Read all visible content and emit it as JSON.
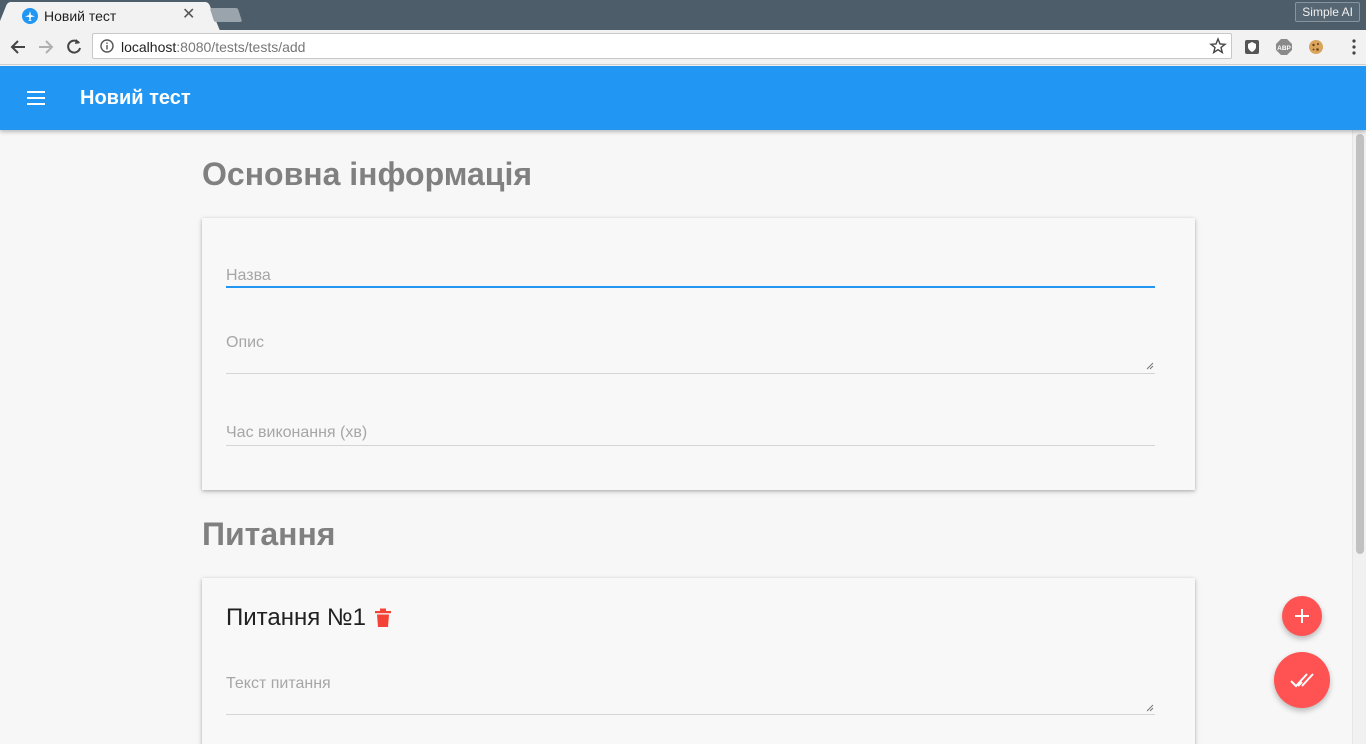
{
  "browser": {
    "tab_title": "Новий тест",
    "tab_close": "✕",
    "profile_name": "Simple AI",
    "url_host": "localhost",
    "url_path": ":8080/tests/tests/add"
  },
  "appbar": {
    "title": "Новий тест",
    "color": "#2196f3"
  },
  "main_info": {
    "heading": "Основна інформація",
    "fields": {
      "name_placeholder": "Назва",
      "description_placeholder": "Опис",
      "time_placeholder": "Час виконання (хв)"
    }
  },
  "questions": {
    "heading": "Питання",
    "items": [
      {
        "title": "Питання №1",
        "text_placeholder": "Текст питання"
      }
    ]
  },
  "colors": {
    "accent": "#ff5252",
    "primary": "#2196f3",
    "delete": "#f44336"
  },
  "icons": {
    "menu": "menu-icon",
    "delete": "trash-icon",
    "add": "plus-icon",
    "done": "double-check-icon"
  }
}
